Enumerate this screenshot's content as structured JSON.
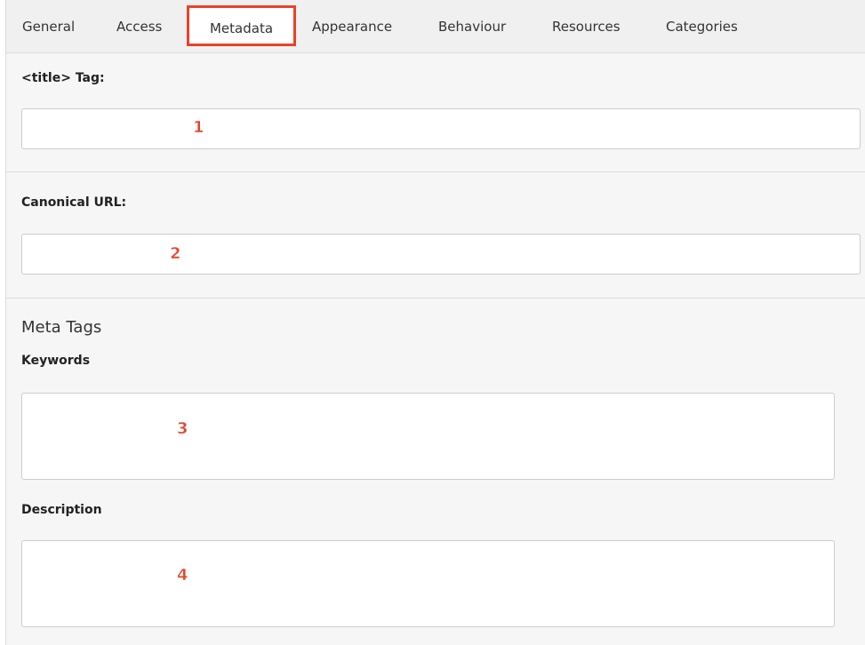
{
  "tabs": [
    {
      "label": "General",
      "active": false
    },
    {
      "label": "Access",
      "active": false
    },
    {
      "label": "Metadata",
      "active": true
    },
    {
      "label": "Appearance",
      "active": false
    },
    {
      "label": "Behaviour",
      "active": false
    },
    {
      "label": "Resources",
      "active": false
    },
    {
      "label": "Categories",
      "active": false
    }
  ],
  "title_tag": {
    "label": "<title> Tag:",
    "value": "",
    "marker": "1"
  },
  "canonical_url": {
    "label": "Canonical URL:",
    "value": "",
    "marker": "2"
  },
  "meta_tags": {
    "heading": "Meta Tags",
    "keywords": {
      "label": "Keywords",
      "value": "",
      "marker": "3"
    },
    "description": {
      "label": "Description",
      "value": "",
      "marker": "4"
    }
  },
  "colors": {
    "highlight": "#e8432a",
    "background": "#f6f6f6",
    "tabbar": "#f0f0f0"
  }
}
